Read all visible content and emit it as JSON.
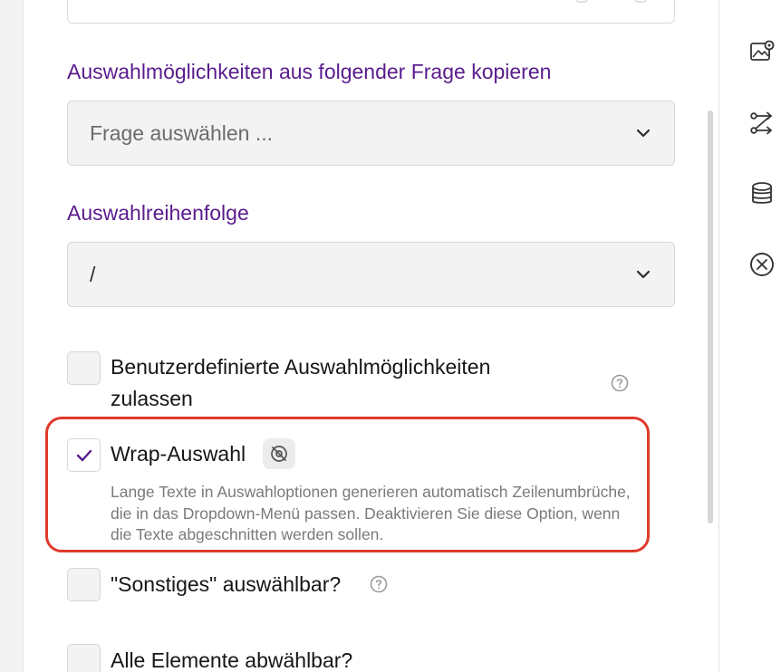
{
  "form": {
    "copy_choices": {
      "label": "Auswahlmöglichkeiten aus folgender Frage kopieren",
      "placeholder": "Frage auswählen ..."
    },
    "choice_order": {
      "label": "Auswahlreihenfolge",
      "value": "/"
    },
    "options": [
      {
        "label_line1": "Benutzerdefinierte Auswahlmöglichkeiten",
        "label_line2": "zulassen",
        "checked": false,
        "help_icon": "question-circle-icon"
      },
      {
        "label": "Wrap-Auswahl",
        "checked": true,
        "badge_icon": "eye-off-icon",
        "description": "Lange Texte in Auswahloptionen generieren automatisch Zeilenumbrüche, die in das Dropdown-Menü passen. Deaktivieren Sie diese Option, wenn die Texte abgeschnitten werden sollen."
      },
      {
        "label": "\"Sonstiges\" auswählbar?",
        "checked": false,
        "help_icon": "question-circle-icon"
      },
      {
        "label": "Alle Elemente abwählbar?",
        "checked": false
      }
    ]
  },
  "sidebar_icons": [
    "image-settings-icon",
    "logic-flow-icon",
    "database-icon",
    "close-circle-icon"
  ],
  "colors": {
    "accent": "#5a1b8c",
    "highlight": "#e0392b",
    "field_bg": "#f3f3f3"
  }
}
